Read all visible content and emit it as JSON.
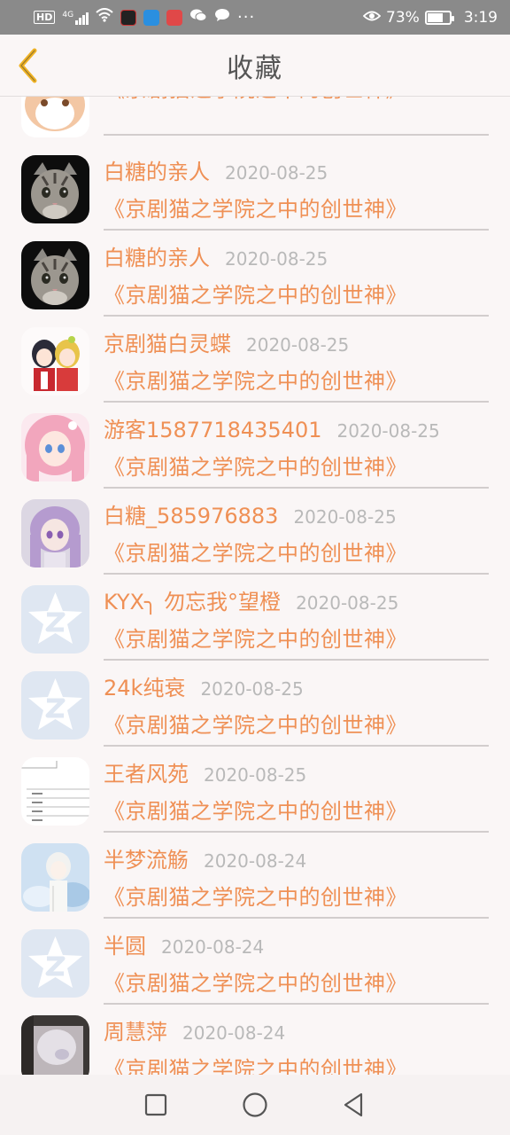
{
  "status_bar": {
    "network_label": "HD",
    "signal_label": "4G",
    "battery_percent": "73%",
    "battery_level": 0.73,
    "time": "3:19",
    "more_label": "···"
  },
  "header": {
    "title": "收藏",
    "accent_color": "#f0b324"
  },
  "colors": {
    "name": "#ef9055",
    "date": "#b9b9b9",
    "divider": "#d2cdcd"
  },
  "items": [
    {
      "name": "",
      "date": "",
      "book": "《京剧猫之学院之中的创世神》",
      "avatar": "cat-cartoon"
    },
    {
      "name": "白糖的亲人",
      "date": "2020-08-25",
      "book": "《京剧猫之学院之中的创世神》",
      "avatar": "tabby-cat"
    },
    {
      "name": "白糖的亲人",
      "date": "2020-08-25",
      "book": "《京剧猫之学院之中的创世神》",
      "avatar": "tabby-cat"
    },
    {
      "name": "京剧猫白灵蝶",
      "date": "2020-08-25",
      "book": "《京剧猫之学院之中的创世神》",
      "avatar": "anime-duo"
    },
    {
      "name": "游客1587718435401",
      "date": "2020-08-25",
      "book": "《京剧猫之学院之中的创世神》",
      "avatar": "anime-pink"
    },
    {
      "name": "白糖_585976883",
      "date": "2020-08-25",
      "book": "《京剧猫之学院之中的创世神》",
      "avatar": "anime-purple"
    },
    {
      "name": "KYX╮ 勿忘我°望橙",
      "date": "2020-08-25",
      "book": "《京剧猫之学院之中的创世神》",
      "avatar": "qq-default"
    },
    {
      "name": "24k纯衰",
      "date": "2020-08-25",
      "book": "《京剧猫之学院之中的创世神》",
      "avatar": "qq-default"
    },
    {
      "name": "王者风苑",
      "date": "2020-08-25",
      "book": "《京剧猫之学院之中的创世神》",
      "avatar": "document"
    },
    {
      "name": "半梦流觞",
      "date": "2020-08-24",
      "book": "《京剧猫之学院之中的创世神》",
      "avatar": "anime-white"
    },
    {
      "name": "半圆",
      "date": "2020-08-24",
      "book": "《京剧猫之学院之中的创世神》",
      "avatar": "qq-default"
    },
    {
      "name": "周慧萍",
      "date": "2020-08-24",
      "book": "《京剧猫之学院之中的创世神》",
      "avatar": "photo-blur"
    }
  ],
  "nav": {
    "recents": "square-icon",
    "home": "circle-icon",
    "back": "triangle-back-icon"
  }
}
